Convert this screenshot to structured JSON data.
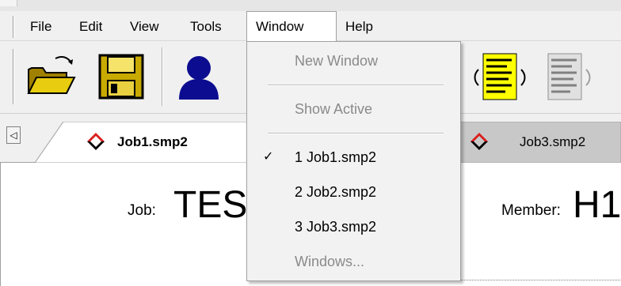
{
  "menubar": {
    "items": [
      {
        "label": "File"
      },
      {
        "label": "Edit"
      },
      {
        "label": "View"
      },
      {
        "label": "Tools"
      },
      {
        "label": "Window"
      },
      {
        "label": "Help"
      }
    ]
  },
  "toolbar": {
    "buttons": [
      {
        "icon": "open-folder-icon"
      },
      {
        "icon": "save-icon"
      },
      {
        "icon": "user-icon"
      },
      {
        "icon": "yellow-document-icon"
      },
      {
        "icon": "gray-document-icon"
      }
    ]
  },
  "tabs": [
    {
      "label": "Job1.smp2",
      "active": true
    },
    {
      "label": "Job3.smp2",
      "active": false
    }
  ],
  "content": {
    "job_label": "Job:",
    "job_value": "TES",
    "member_label": "Member:",
    "member_value": "H1"
  },
  "window_menu": {
    "new_window": "New Window",
    "show_active": "Show Active",
    "check_mark": "✓",
    "entries": [
      {
        "label": "1 Job1.smp2",
        "checked": true
      },
      {
        "label": "2 Job2.smp2",
        "checked": false
      },
      {
        "label": "3 Job3.smp2",
        "checked": false
      }
    ],
    "windows": "Windows..."
  },
  "colors": {
    "accent_red": "#d81e1e",
    "folder_yellow": "#d4b000",
    "user_blue": "#0c0c90",
    "highlight_yellow": "#ffff00"
  }
}
